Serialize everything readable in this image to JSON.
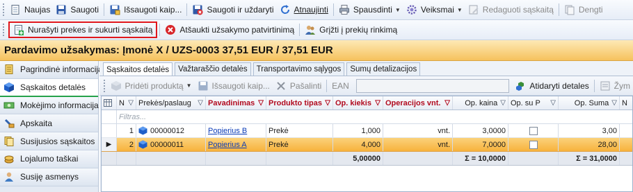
{
  "toolbar1": {
    "new": "Naujas",
    "save": "Saugoti",
    "save_as": "Išsaugoti kaip...",
    "save_close": "Saugoti ir uždaryti",
    "refresh": "Atnaujinti",
    "print": "Spausdinti",
    "actions": "Veiksmai",
    "edit_invoice": "Redaguoti sąskaitą",
    "copies": "Dengti"
  },
  "toolbar2": {
    "write_off": "Nurašyti prekes ir sukurti sąskaitą",
    "cancel_confirm": "Atšaukti užsakymo patvirtinimą",
    "back_to_set": "Grįžti į prekių rinkimą"
  },
  "title": "Pardavimo užsakymas: Įmonė X / UZS-0003 37,51 EUR / 37,51 EUR",
  "left_nav": [
    {
      "label": "Pagrindinė informacija",
      "icon": "document-icon"
    },
    {
      "label": "Sąskaitos detalės",
      "icon": "blue-cube-icon",
      "active": true
    },
    {
      "label": "Mokėjimo informacija",
      "icon": "money-icon"
    },
    {
      "label": "Apskaita",
      "icon": "stamp-icon"
    },
    {
      "label": "Susijusios sąskaitos",
      "icon": "documents-icon"
    },
    {
      "label": "Lojalumo taškai",
      "icon": "coins-icon"
    },
    {
      "label": "Susiję asmenys",
      "icon": "person-icon"
    }
  ],
  "tabs": [
    "Sąskaitos detalės",
    "Važtaraščio detalės",
    "Transportavimo sąlygos",
    "Sumų detalizacijos"
  ],
  "toolbar3": {
    "add_product": "Pridėti produktą",
    "save_as": "Išsaugoti kaip...",
    "delete": "Pašalinti",
    "ean_label": "EAN",
    "ean_value": "",
    "open_details": "Atidaryti detales",
    "more": "Žym"
  },
  "grid": {
    "columns": [
      "N",
      "Prekės/paslaug",
      "Pavadinimas",
      "Produkto tipas",
      "Op. kiekis",
      "Operacijos vnt.",
      "Op. kaina",
      "Op. su P",
      "Op. Suma",
      "N"
    ],
    "filter_placeholder": "Filtras...",
    "rows": [
      {
        "n": "1",
        "code": "00000012",
        "name": "Popierius B",
        "type": "Prekė",
        "qty": "1,000",
        "unit": "vnt.",
        "price": "3,0000",
        "with_vat": false,
        "sum": "3,00",
        "selected": false
      },
      {
        "n": "2",
        "code": "00000011",
        "name": "Popierius A",
        "type": "Prekė",
        "qty": "4,000",
        "unit": "vnt.",
        "price": "7,0000",
        "with_vat": false,
        "sum": "28,00",
        "selected": true
      }
    ],
    "totals": {
      "qty": "5,00000",
      "price": "Σ = 10,0000",
      "sum": "Σ = 31,0000"
    }
  },
  "colors": {
    "highlight_border": "#e0161b",
    "title_band": "#f6c25d",
    "selected_row": "#f7b23c",
    "active_nav_underline": "#25a24a"
  }
}
